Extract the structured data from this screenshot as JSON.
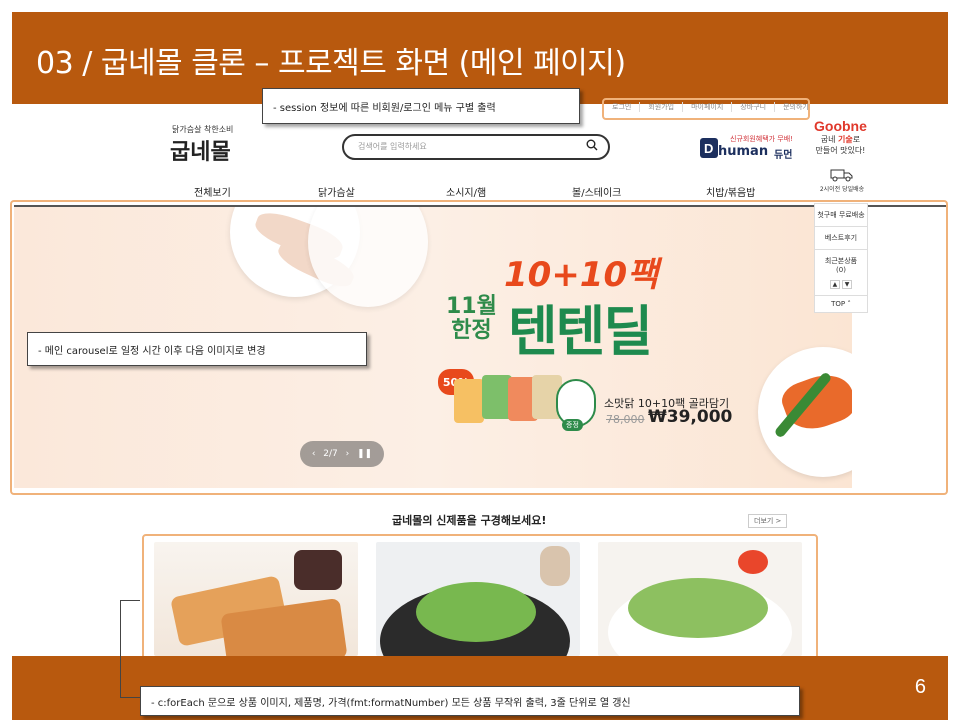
{
  "slide": {
    "title": "03 / 굽네몰 클론 – 프로젝트 화면 (메인 페이지)",
    "page_number": "6"
  },
  "notes": {
    "session": "- session 정보에 따른 비회원/로그인 메뉴 구별 출력",
    "carousel": "- 메인 carousel로 일정 시간 이후 다음 이미지로 변경",
    "products": "- c:forEach 문으로 상품 이미지, 제품명, 가격(fmt:formatNumber) 모든 상품 무작위 출력, 3줄 단위로 열 갱신"
  },
  "top_links": [
    "로그인",
    "회원가입",
    "마이페이지",
    "장바구니",
    "문의하기"
  ],
  "logo": {
    "tagline": "닭가슴살 착한소비",
    "name": "굽네몰"
  },
  "search": {
    "placeholder": "검색어를 입력하세요"
  },
  "human_banner": {
    "sub": "신규회원혜택가 무배!",
    "brand": "human",
    "brand_ko": "듀먼"
  },
  "goobne_banner": {
    "brand": "Goobne",
    "line1_pre": "굽네 ",
    "line1_hl": "기술",
    "line1_post": "로",
    "line2": "만들어 맛있다!"
  },
  "nav": [
    "전체보기",
    "닭가슴살",
    "소시지/햄",
    "볼/스테이크",
    "치밥/볶음밥"
  ],
  "side_panel": {
    "delivery": "2시이전 당일배송",
    "free_ship": "첫구매 무료배송",
    "best_review": "베스트후기",
    "recent": "최근본상품",
    "recent_count": "(0)",
    "top": "TOP"
  },
  "hero": {
    "headline": "10+10팩",
    "month_line1": "11월",
    "month_line2": "한정",
    "event": "텐텐딜",
    "discount": "50%",
    "product_name": "소맛닭 10+10팩 골라담기",
    "old_price": "78,000",
    "new_price": "₩39,000",
    "gift_label": "증정",
    "pager": "2/7"
  },
  "new_products": {
    "heading": "굽네몰의 신제품을 구경해보세요!",
    "more": "더보기 >"
  },
  "colors": {
    "accent": "#b8590e",
    "highlight": "#f0b27a",
    "brand_green": "#1e8a4e",
    "brand_red": "#e8491c"
  }
}
